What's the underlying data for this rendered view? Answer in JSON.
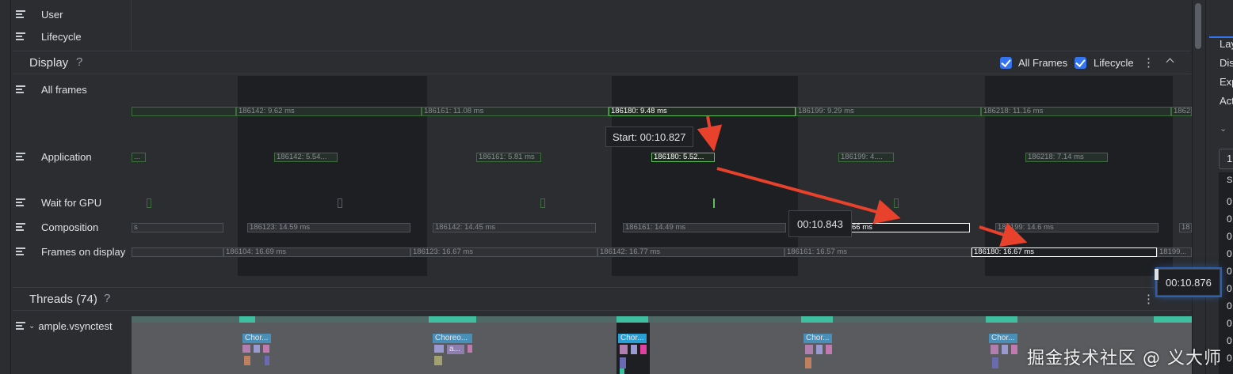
{
  "top_tracks": [
    {
      "label": "User"
    },
    {
      "label": "Lifecycle"
    }
  ],
  "display": {
    "title": "Display",
    "help": "?",
    "all_frames_checkbox": "All Frames",
    "lifecycle_checkbox": "Lifecycle",
    "menu": "⋮",
    "tracks": [
      "All frames",
      "Application",
      "Wait for GPU",
      "Composition",
      "Frames on display"
    ]
  },
  "all_frames_bars": [
    "186142: 9.62 ms",
    "186161: 11.08 ms",
    "186180: 9.48 ms",
    "186199: 9.29 ms",
    "186218: 11.16 ms",
    "18623"
  ],
  "application_bars": [
    "...",
    "186142: 5.54...",
    "186161: 5.81 ms",
    "186180: 5.52...",
    "186199: 4....",
    "186218: 7.14 ms"
  ],
  "composition_bars": [
    "s",
    "186123: 14.59 ms",
    "186142: 14.45 ms",
    "186161: 14.49 ms",
    "66 ms",
    "186199: 14.6 ms",
    "18"
  ],
  "display_bars": [
    "186104: 16.69 ms",
    "186123: 16.67 ms",
    "186142: 16.77 ms",
    "186161: 16.57 ms",
    "186180: 16.67 ms",
    "18199..."
  ],
  "tooltips": {
    "start": "Start: 00:10.827",
    "mid": "00:10.843",
    "end": "00:10.876"
  },
  "threads": {
    "title": "Threads (74)",
    "help": "?",
    "menu": "⋮",
    "process_label": "ample.vsynctest",
    "chor_labels": [
      "Chor...",
      "Choreo...",
      "Chor...",
      "Chor...",
      "Chor..."
    ],
    "sub_label": "a..."
  },
  "right_panel": {
    "items": [
      "Lay",
      "Dis",
      "Exp",
      "Act"
    ],
    "value": "1",
    "column_head": "S",
    "rows": [
      "0",
      "0",
      "0",
      "0",
      "0",
      "0",
      "0",
      "0",
      "0",
      "0",
      "0",
      "0"
    ]
  },
  "watermark": "掘金技术社区 @ 义大师",
  "colors": {
    "accent": "#3574f0",
    "annotation_arrow": "#e8412c",
    "frame_green": "#5fbf5f",
    "thread_teal": "#3fbf9f"
  }
}
